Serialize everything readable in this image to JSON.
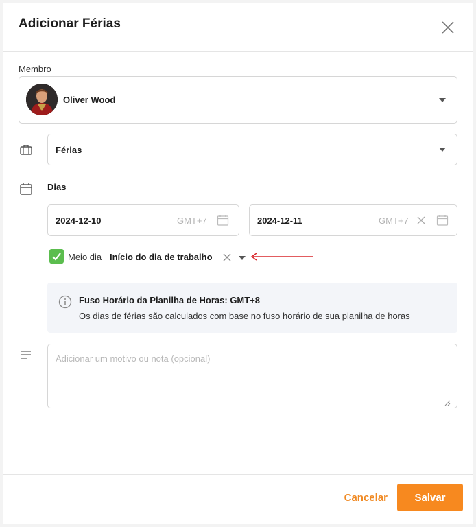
{
  "modal": {
    "title": "Adicionar Férias"
  },
  "member": {
    "label": "Membro",
    "selected_name": "Oliver Wood"
  },
  "leave_type": {
    "selected": "Férias"
  },
  "days": {
    "label": "Dias",
    "start_date": "2024-12-10",
    "start_timezone": "GMT+7",
    "end_date": "2024-12-11",
    "end_timezone": "GMT+7"
  },
  "half_day": {
    "checked": true,
    "label": "Meio dia",
    "selected_option": "Início do dia de trabalho"
  },
  "info": {
    "title": "Fuso Horário da Planilha de Horas: GMT+8",
    "text": "Os dias de férias são calculados com base no fuso horário de sua planilha de horas"
  },
  "note": {
    "value": "",
    "placeholder": "Adicionar um motivo ou nota (opcional)"
  },
  "footer": {
    "cancel_label": "Cancelar",
    "save_label": "Salvar"
  },
  "colors": {
    "accent": "#f7891f",
    "check_green": "#5bbd4e",
    "annotation_arrow": "#d9262b",
    "info_bg": "#f3f5f9"
  },
  "icons": {
    "close": "close-icon",
    "dropdown": "caret-down-icon",
    "leave_type": "briefcase-icon",
    "days": "calendar-icon",
    "date_picker": "calendar-icon",
    "clear": "clear-icon",
    "info": "info-icon",
    "note": "text-lines-icon"
  }
}
